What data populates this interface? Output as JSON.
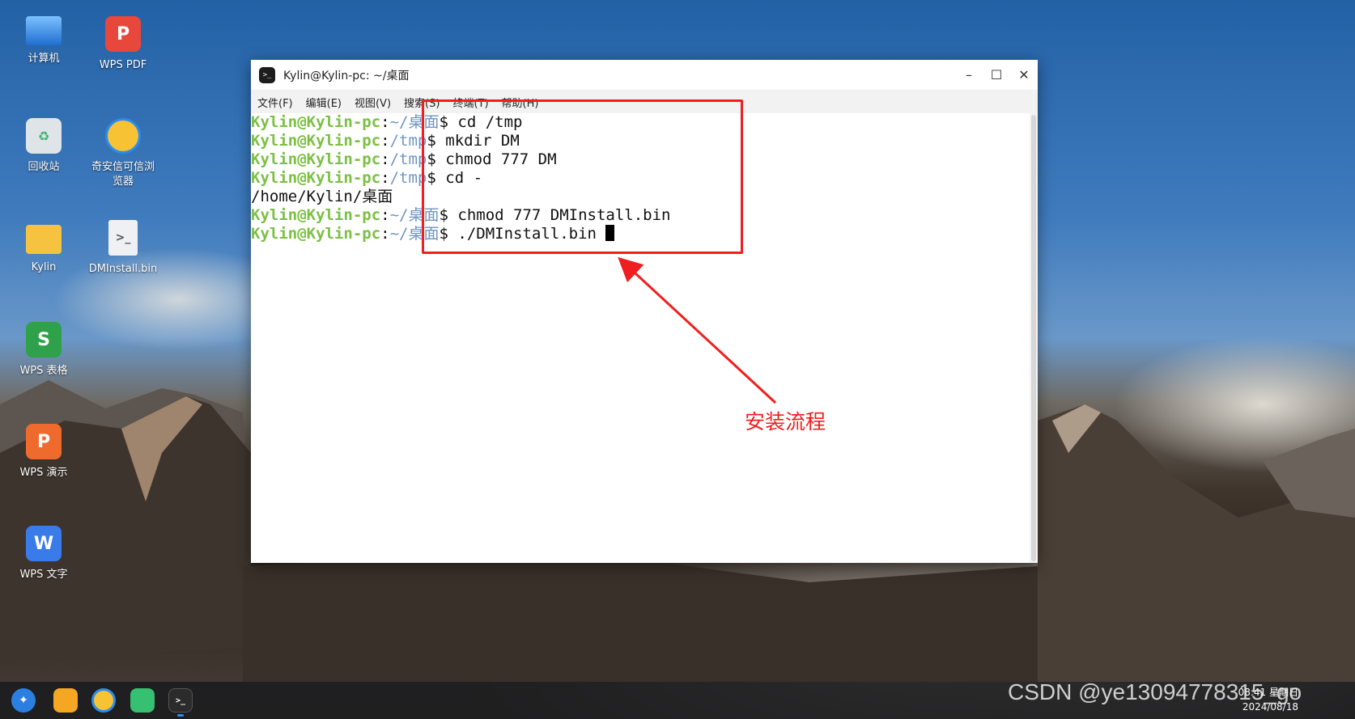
{
  "desktop": {
    "icons": [
      {
        "label": "计算机",
        "icon": "computer-icon"
      },
      {
        "label": "WPS PDF",
        "icon": "wps-pdf-icon"
      },
      {
        "label": "回收站",
        "icon": "recycle-bin-icon"
      },
      {
        "label": "奇安信可信浏览器",
        "icon": "browser-icon"
      },
      {
        "label": "Kylin",
        "icon": "folder-icon"
      },
      {
        "label": "DMInstall.bin",
        "icon": "file-icon"
      },
      {
        "label": "WPS 表格",
        "icon": "wps-spreadsheet-icon"
      },
      {
        "label": "WPS 演示",
        "icon": "wps-presentation-icon"
      },
      {
        "label": "WPS 文字",
        "icon": "wps-writer-icon"
      }
    ]
  },
  "window": {
    "title": "Kylin@Kylin-pc: ~/桌面",
    "menu": [
      "文件(F)",
      "编辑(E)",
      "视图(V)",
      "搜索(S)",
      "终端(T)",
      "帮助(H)"
    ]
  },
  "terminal": {
    "lines": [
      {
        "user": "Kylin@Kylin-pc",
        "sep": ":",
        "path": "~/桌面",
        "cmd": "$ cd /tmp"
      },
      {
        "user": "Kylin@Kylin-pc",
        "sep": ":",
        "path": "/tmp",
        "cmd": "$ mkdir DM"
      },
      {
        "user": "Kylin@Kylin-pc",
        "sep": ":",
        "path": "/tmp",
        "cmd": "$ chmod 777 DM"
      },
      {
        "user": "Kylin@Kylin-pc",
        "sep": ":",
        "path": "/tmp",
        "cmd": "$ cd -"
      },
      {
        "output": "/home/Kylin/桌面"
      },
      {
        "user": "Kylin@Kylin-pc",
        "sep": ":",
        "path": "~/桌面",
        "cmd": "$ chmod 777 DMInstall.bin"
      },
      {
        "user": "Kylin@Kylin-pc",
        "sep": ":",
        "path": "~/桌面",
        "cmd": "$ ./DMInstall.bin ",
        "cursor": true
      }
    ]
  },
  "annotation": {
    "text": "安装流程",
    "color": "#f01f1f"
  },
  "taskbar": {
    "time": "08:41 星期日",
    "date": "2024/08/18"
  },
  "watermark": "CSDN @ye13094778315_go"
}
